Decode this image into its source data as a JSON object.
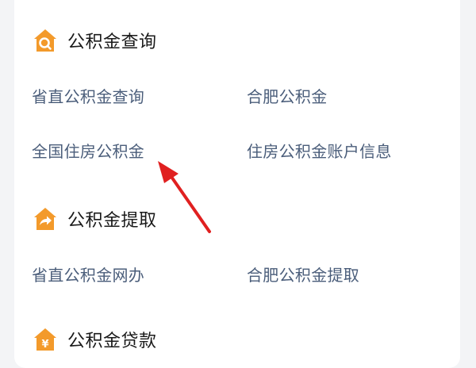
{
  "colors": {
    "icon_orange": "#F39A2B",
    "link_text": "#4A5D7A",
    "title_text": "#1A1A1A",
    "arrow_red": "#E02020"
  },
  "sections": [
    {
      "title": "公积金查询",
      "icon": "house-search-icon",
      "links": [
        "省直公积金查询",
        "合肥公积金",
        "全国住房公积金",
        "住房公积金账户信息"
      ]
    },
    {
      "title": "公积金提取",
      "icon": "house-share-icon",
      "links": [
        "省直公积金网办",
        "合肥公积金提取"
      ]
    },
    {
      "title": "公积金贷款",
      "icon": "house-yen-icon",
      "links": []
    }
  ]
}
